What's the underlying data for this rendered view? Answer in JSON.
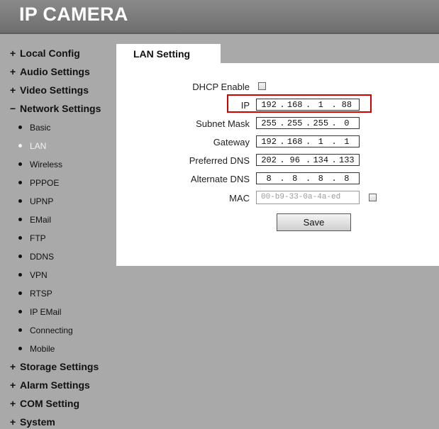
{
  "app": {
    "title": "IP CAMERA"
  },
  "sidebar": {
    "sections_top": [
      {
        "prefix": "+",
        "label": "Local Config"
      },
      {
        "prefix": "+",
        "label": "Audio Settings"
      },
      {
        "prefix": "+",
        "label": "Video Settings"
      },
      {
        "prefix": "−",
        "label": "Network Settings"
      }
    ],
    "network_items": [
      "Basic",
      "LAN",
      "Wireless",
      "PPPOE",
      "UPNP",
      "EMail",
      "FTP",
      "DDNS",
      "VPN",
      "RTSP",
      "IP EMail",
      "Connecting",
      "Mobile"
    ],
    "active_item": "LAN",
    "sections_bottom": [
      {
        "prefix": "+",
        "label": "Storage Settings"
      },
      {
        "prefix": "+",
        "label": "Alarm Settings"
      },
      {
        "prefix": "+",
        "label": "COM Setting"
      },
      {
        "prefix": "+",
        "label": "System"
      }
    ]
  },
  "tab": {
    "label": "LAN Setting"
  },
  "form": {
    "dhcp_label": "DHCP Enable",
    "dhcp_checked": false,
    "ip_label": "IP",
    "ip": [
      "192",
      "168",
      "1",
      "88"
    ],
    "subnet_label": "Subnet Mask",
    "subnet": [
      "255",
      "255",
      "255",
      "0"
    ],
    "gateway_label": "Gateway",
    "gateway": [
      "192",
      "168",
      "1",
      "1"
    ],
    "pdns_label": "Preferred DNS",
    "pdns": [
      "202",
      "96",
      "134",
      "133"
    ],
    "adns_label": "Alternate DNS",
    "adns": [
      "8",
      "8",
      "8",
      "8"
    ],
    "mac_label": "MAC",
    "mac_value": "00-b9-33-0a-4a-ed",
    "mac_checked": false,
    "save_label": "Save"
  },
  "colors": {
    "highlight": "#d40000",
    "sidebar_bg": "#a9a9a9",
    "header_bg": "#7a7a7a"
  }
}
